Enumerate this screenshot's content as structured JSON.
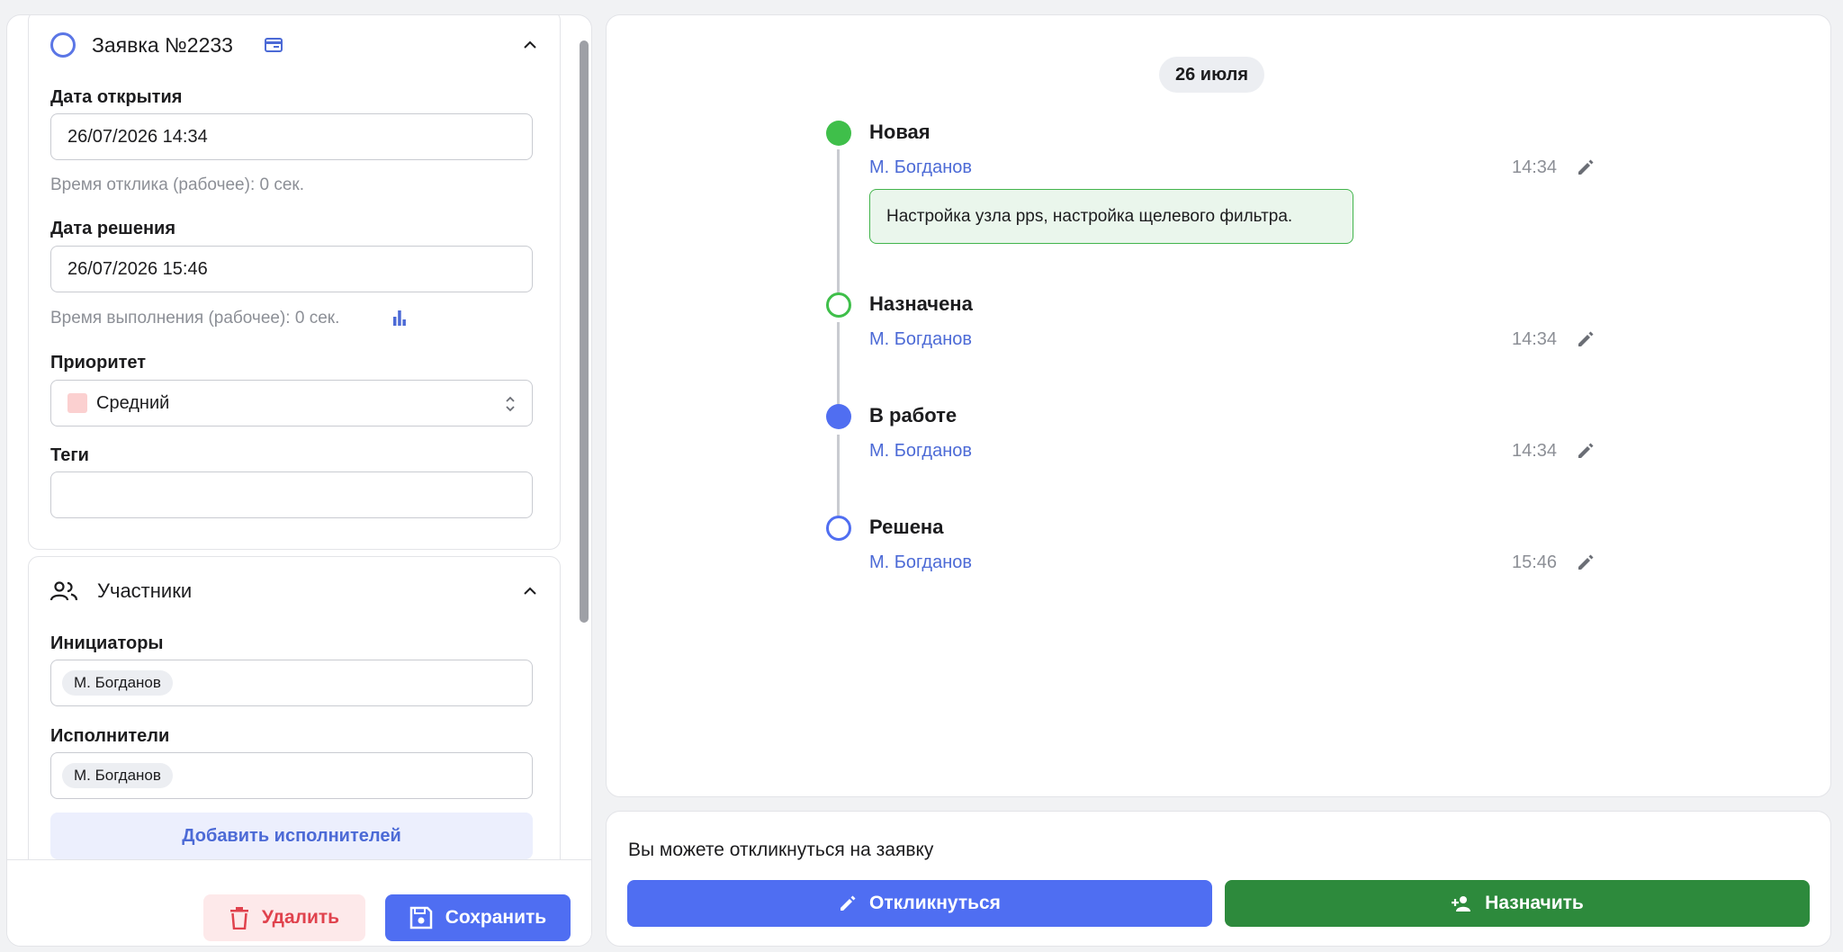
{
  "ticket": {
    "title": "Заявка №2233",
    "open_date_label": "Дата открытия",
    "open_date_value": "26/07/2026 14:34",
    "response_time": "Время отклика (рабочее): 0 сек.",
    "resolve_date_label": "Дата решения",
    "resolve_date_value": "26/07/2026 15:46",
    "execution_time": "Время выполнения (рабочее): 0 сек.",
    "priority_label": "Приоритет",
    "priority_value": "Средний",
    "priority_color": "#fbd0d0",
    "tags_label": "Теги",
    "tags_value": ""
  },
  "participants": {
    "title": "Участники",
    "initiators_label": "Инициаторы",
    "initiators": [
      "М. Богданов"
    ],
    "executors_label": "Исполнители",
    "executors": [
      "М. Богданов"
    ],
    "add_executors_label": "Добавить исполнителей"
  },
  "footer": {
    "delete_label": "Удалить",
    "save_label": "Сохранить"
  },
  "history": {
    "date": "26 июля",
    "events": [
      {
        "status": "Новая",
        "author": "М. Богданов",
        "time": "14:34",
        "comment": "Настройка узла pps, настройка щелевого фильтра.",
        "marker": "green-filled"
      },
      {
        "status": "Назначена",
        "author": "М. Богданов",
        "time": "14:34",
        "marker": "green-ring"
      },
      {
        "status": "В работе",
        "author": "М. Богданов",
        "time": "14:34",
        "marker": "blue-filled"
      },
      {
        "status": "Решена",
        "author": "М. Богданов",
        "time": "15:46",
        "marker": "blue-ring"
      }
    ]
  },
  "actions": {
    "prompt": "Вы можете откликнуться на заявку",
    "respond_label": "Откликнуться",
    "assign_label": "Назначить"
  },
  "colors": {
    "accent": "#4f6ef2",
    "success": "#2d8a3c",
    "danger": "#e0424d",
    "status_green": "#3fbf4a"
  }
}
